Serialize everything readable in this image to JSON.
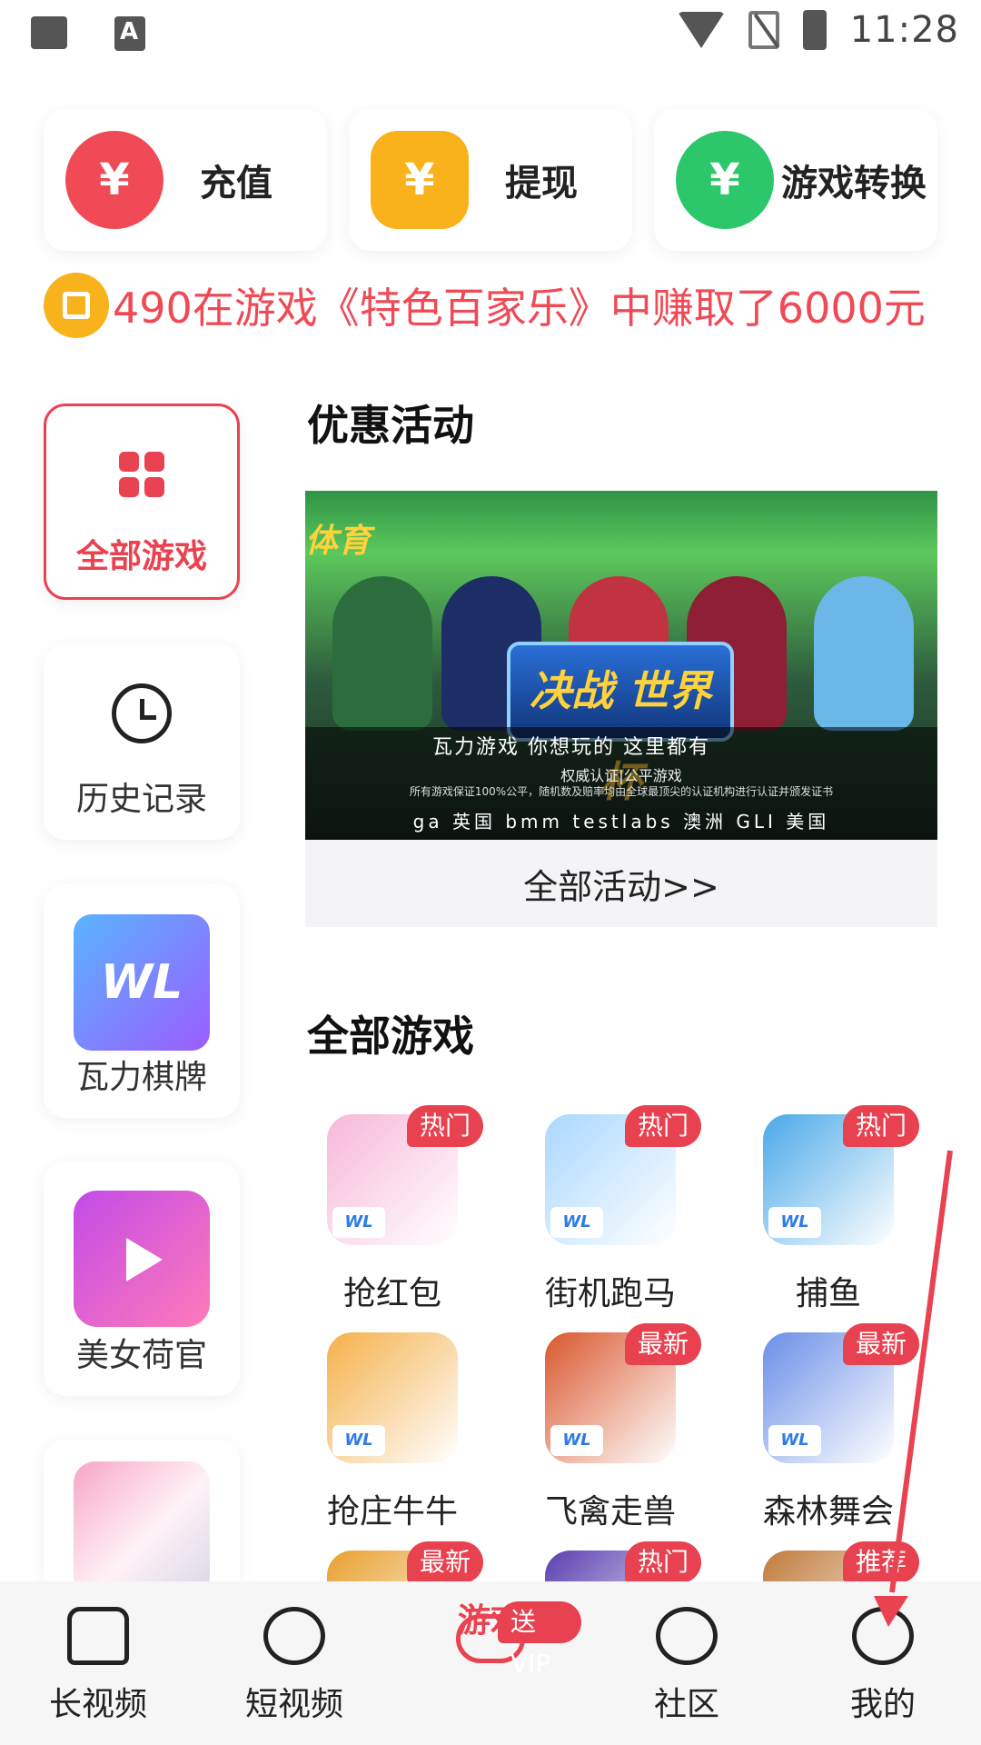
{
  "status_bar": {
    "time": "11:28",
    "icons": [
      "gallery-icon",
      "text-a-icon",
      "wifi-icon",
      "no-sim-icon",
      "battery-charging-icon"
    ]
  },
  "top_actions": [
    {
      "label": "充值",
      "icon": "recharge-icon",
      "color": "#ef4a55",
      "glyph": "¥"
    },
    {
      "label": "提现",
      "icon": "withdraw-icon",
      "color": "#f9b21c",
      "glyph": "¥"
    },
    {
      "label": "游戏转换",
      "icon": "exchange-icon",
      "color": "#2cc76a",
      "glyph": "¥"
    }
  ],
  "ticker": {
    "text": "490在游戏《特色百家乐》中赚取了6000元"
  },
  "sidebar": {
    "items": [
      {
        "label": "全部游戏",
        "icon": "grid-icon"
      },
      {
        "label": "历史记录",
        "icon": "clock-icon"
      },
      {
        "label": "瓦力棋牌",
        "icon": "wali-chess-logo"
      },
      {
        "label": "美女荷官",
        "icon": "live-tv-logo"
      },
      {
        "label": "",
        "icon": "racing-car-logo"
      }
    ]
  },
  "promo": {
    "title": "优惠活动",
    "banner": {
      "tag": "体育",
      "logo_text": "决战 世界杯",
      "slogan": "瓦力游戏 你想玩的 这里都有",
      "certified": "权威认证|公平游戏",
      "disclaimer": "所有游戏保证100%公平，随机数及赔率均由全球最顶尖的认证机构进行认证并颁发证书",
      "auditors": "ga 英国   bmm testlabs 澳洲   GLI 美国"
    },
    "more_label": "全部活动>>"
  },
  "games": {
    "title": "全部游戏",
    "items": [
      {
        "label": "抢红包",
        "badge": "热门",
        "color": "#f7b7d8"
      },
      {
        "label": "街机跑马",
        "badge": "热门",
        "color": "#a9d7ff"
      },
      {
        "label": "捕鱼",
        "badge": "热门",
        "color": "#4aa8e8"
      },
      {
        "label": "抢庄牛牛",
        "badge": "",
        "color": "#f5b04a"
      },
      {
        "label": "飞禽走兽",
        "badge": "最新",
        "color": "#d9572e"
      },
      {
        "label": "森林舞会",
        "badge": "最新",
        "color": "#6a8fe8"
      },
      {
        "label": "",
        "badge": "最新",
        "color": "#e8a030"
      },
      {
        "label": "",
        "badge": "热门",
        "color": "#5a3fb0"
      },
      {
        "label": "",
        "badge": "推荐",
        "color": "#c07a3a"
      }
    ]
  },
  "bottom_nav": {
    "items": [
      {
        "label": "长视频",
        "icon": "home-icon"
      },
      {
        "label": "短视频",
        "icon": "play-circle-icon"
      },
      {
        "label": "游戏",
        "icon": "gamepad-icon",
        "badge": "送VIP",
        "active": true
      },
      {
        "label": "社区",
        "icon": "chat-icon"
      },
      {
        "label": "我的",
        "icon": "robot-profile-icon"
      }
    ]
  },
  "colors": {
    "accent": "#e94250",
    "ticker": "#ef4a55",
    "bg": "#ffffff"
  }
}
